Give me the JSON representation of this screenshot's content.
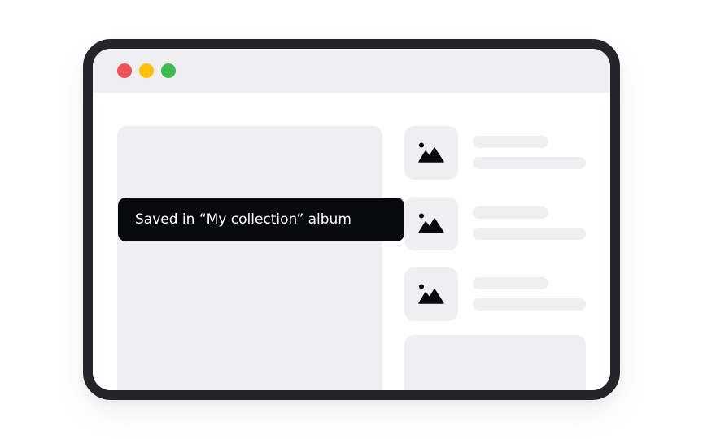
{
  "window": {
    "controls": [
      {
        "name": "close",
        "color": "#f0525a"
      },
      {
        "name": "minimize",
        "color": "#ffc00b"
      },
      {
        "name": "maximize",
        "color": "#3ebb4f"
      }
    ]
  },
  "list": {
    "items": [
      {
        "icon": "image-icon"
      },
      {
        "icon": "image-icon"
      },
      {
        "icon": "image-icon"
      }
    ]
  },
  "toast": {
    "message": "Saved in “My collection” album"
  },
  "colors": {
    "frame": "#24242b",
    "placeholder": "#efeff1",
    "toast_background": "#08080f",
    "toast_text": "#ffffff"
  }
}
